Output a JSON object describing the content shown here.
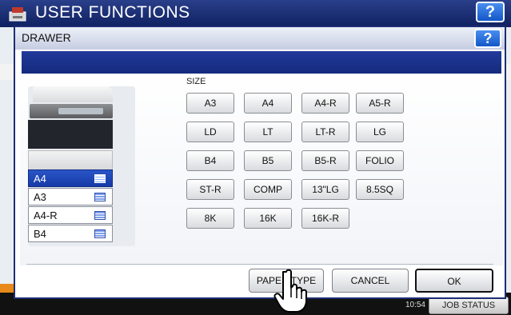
{
  "background": {
    "title": "USER FUNCTIONS",
    "help": "?",
    "time": "10:54",
    "job_status": "JOB STATUS"
  },
  "dialog": {
    "title": "DRAWER",
    "help": "?",
    "size_label": "SIZE",
    "drawers": [
      {
        "label": "A4",
        "selected": true
      },
      {
        "label": "A3",
        "selected": false
      },
      {
        "label": "A4-R",
        "selected": false
      },
      {
        "label": "B4",
        "selected": false
      }
    ],
    "sizes": [
      [
        "A3",
        "A4",
        "A4-R",
        "A5-R"
      ],
      [
        "LD",
        "LT",
        "LT-R",
        "LG"
      ],
      [
        "B4",
        "B5",
        "B5-R",
        "FOLIO"
      ],
      [
        "ST-R",
        "COMP",
        "13\"LG",
        "8.5SQ"
      ],
      [
        "8K",
        "16K",
        "16K-R"
      ]
    ],
    "buttons": {
      "paper_type": "PAPER TYPE",
      "cancel": "CANCEL",
      "ok": "OK"
    }
  },
  "colors": {
    "accent": "#1d3a9a",
    "selected": "#1e47b8"
  }
}
